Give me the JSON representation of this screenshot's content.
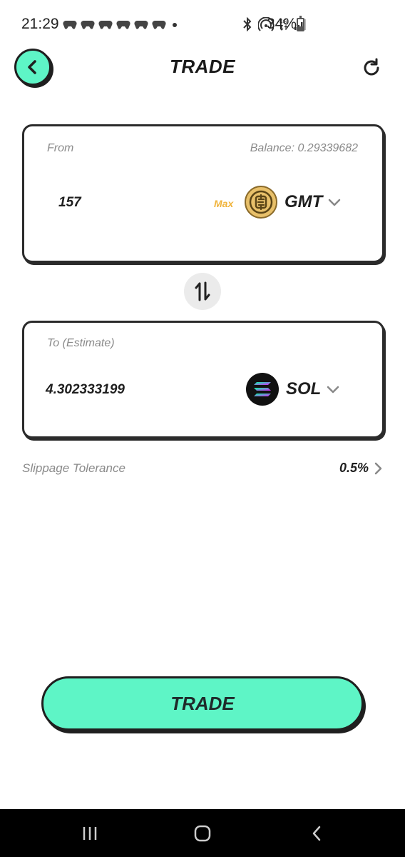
{
  "status_bar": {
    "time": "21:29",
    "notification_icons": [
      "game-controller-icon",
      "game-controller-icon",
      "game-controller-icon",
      "game-controller-icon",
      "game-controller-icon",
      "game-controller-icon"
    ],
    "network": "4G",
    "battery_percent": "34%",
    "battery_level": 0.34
  },
  "header": {
    "title": "TRADE"
  },
  "from_card": {
    "label": "From",
    "balance": "Balance: 0.29339682",
    "amount": "157",
    "max_label": "Max",
    "token_symbol": "GMT",
    "token_color": "#e8c06a"
  },
  "to_card": {
    "label": "To (Estimate)",
    "amount": "4.302333199",
    "token_symbol": "SOL",
    "token_color": "#111111"
  },
  "slippage": {
    "label": "Slippage Tolerance",
    "value": "0.5%"
  },
  "trade_button": {
    "label": "TRADE"
  },
  "colors": {
    "accent": "#5ef5c6",
    "max": "#f0b43c",
    "border": "#1f1f1f",
    "muted_text": "#8a8a8a"
  }
}
